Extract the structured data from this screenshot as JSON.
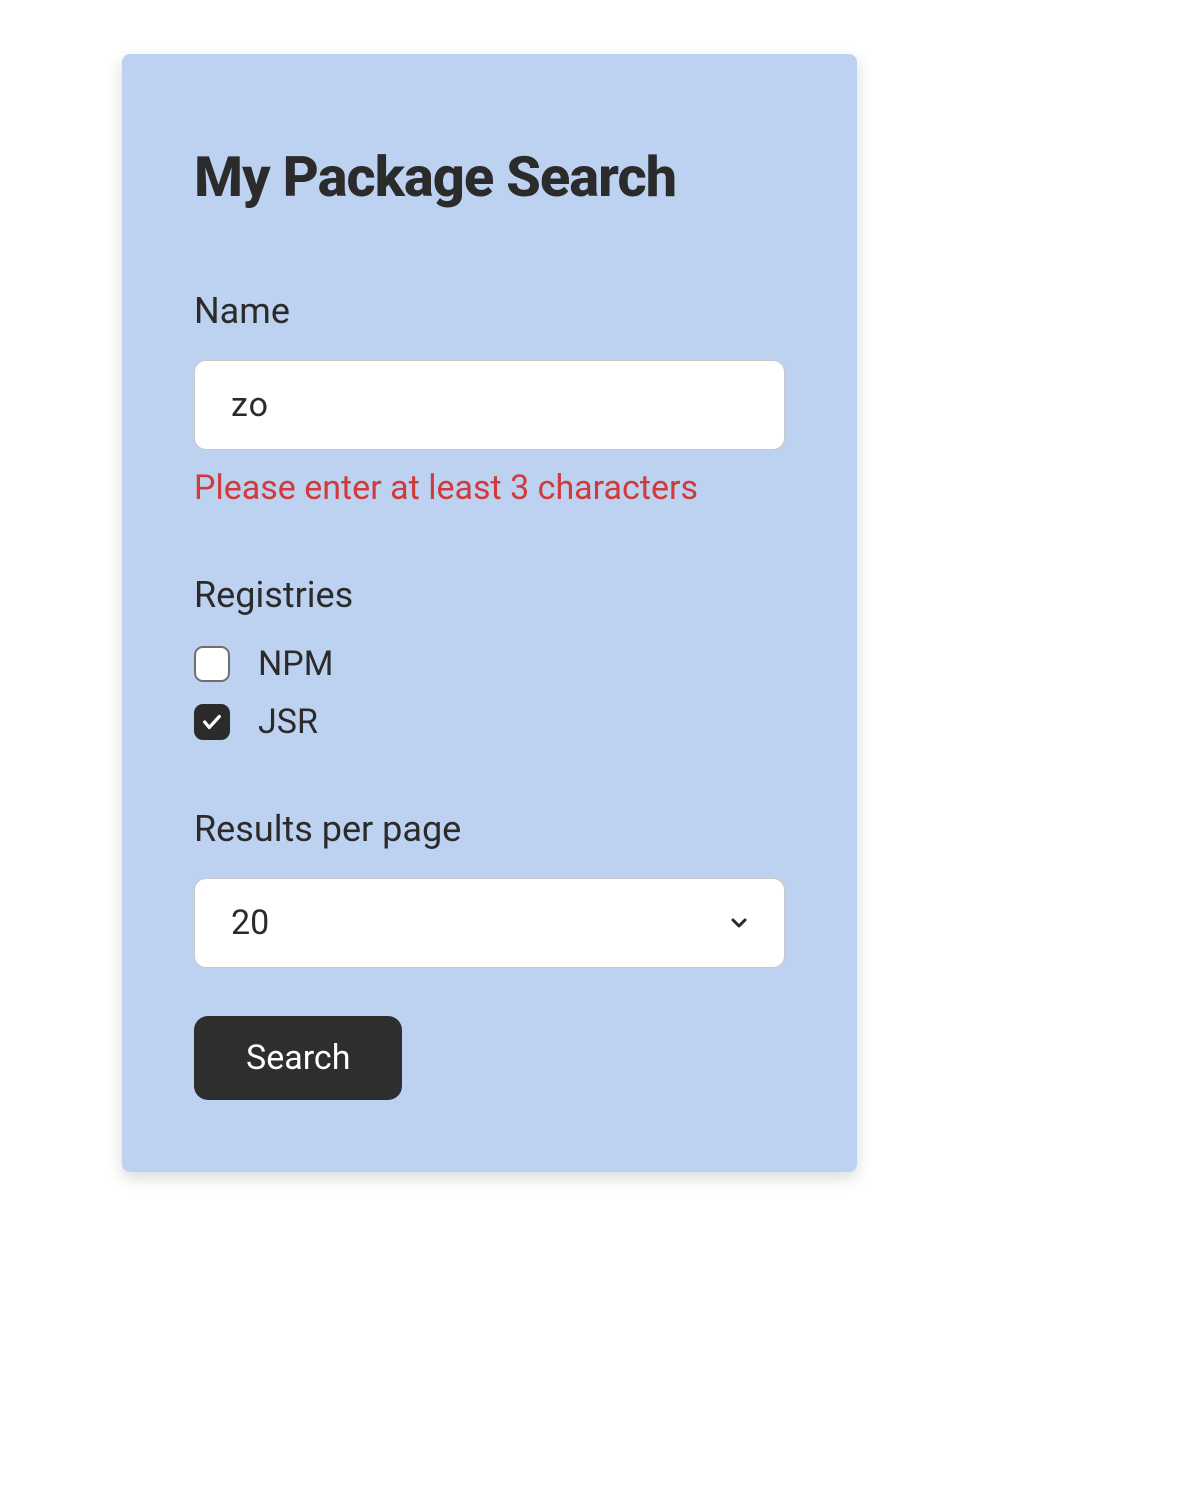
{
  "card": {
    "title": "My Package Search",
    "name_field": {
      "label": "Name",
      "value": "zo",
      "error": "Please enter at least 3 characters"
    },
    "registries": {
      "label": "Registries",
      "options": [
        {
          "label": "NPM",
          "checked": false
        },
        {
          "label": "JSR",
          "checked": true
        }
      ]
    },
    "results_per_page": {
      "label": "Results per page",
      "value": "20"
    },
    "search_button": "Search"
  }
}
